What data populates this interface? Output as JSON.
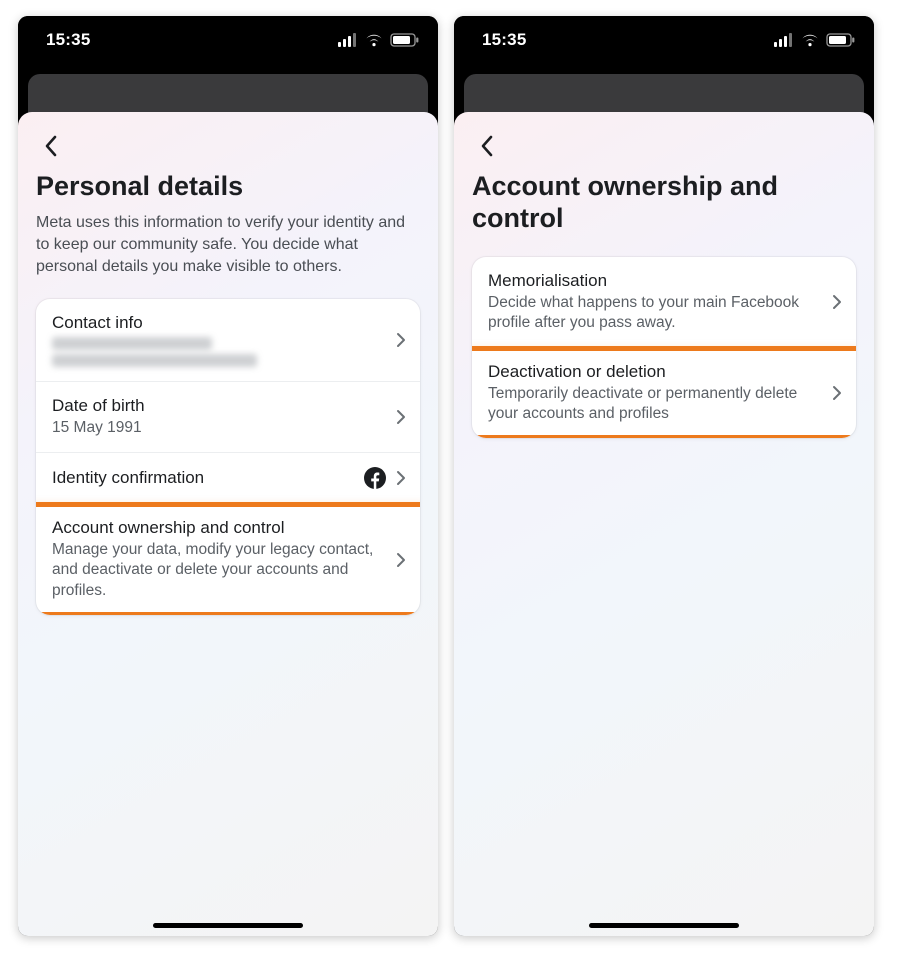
{
  "status": {
    "time": "15:35"
  },
  "left": {
    "title": "Personal details",
    "desc": "Meta uses this information to verify your identity and to keep our community safe. You decide what personal details you make visible to others.",
    "rows": {
      "contact": {
        "title": "Contact info"
      },
      "dob": {
        "title": "Date of birth",
        "sub": "15 May 1991"
      },
      "identity": {
        "title": "Identity confirmation"
      },
      "ownership": {
        "title": "Account ownership and control",
        "sub": "Manage your data, modify your legacy contact, and deactivate or delete your accounts and profiles."
      }
    }
  },
  "right": {
    "title": "Account ownership and control",
    "rows": {
      "memorial": {
        "title": "Memorialisation",
        "sub": "Decide what happens to your main Facebook profile after you pass away."
      },
      "deactivate": {
        "title": "Deactivation or deletion",
        "sub": "Temporarily deactivate or permanently delete your accounts and profiles"
      }
    }
  }
}
